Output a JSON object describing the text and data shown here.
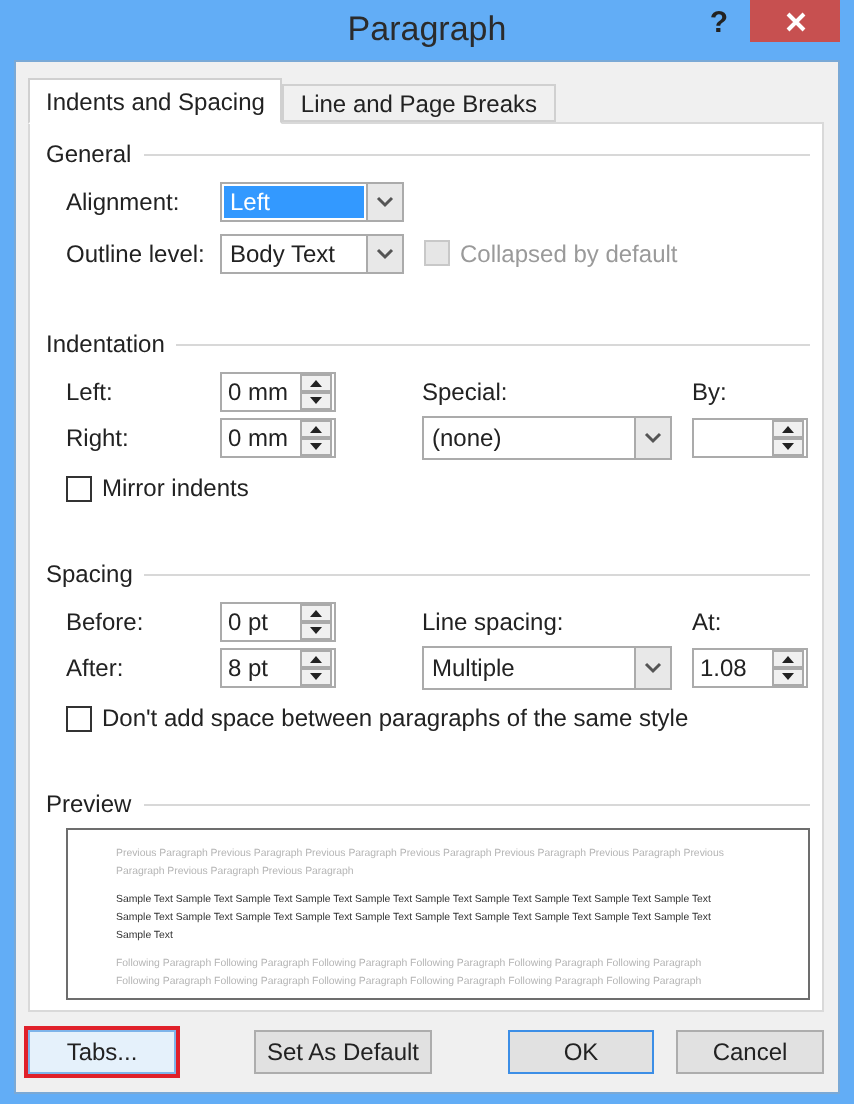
{
  "window": {
    "title": "Paragraph",
    "help": "?"
  },
  "tabs": [
    {
      "label": "Indents and Spacing",
      "selected": true
    },
    {
      "label": "Line and Page Breaks",
      "selected": false
    }
  ],
  "general": {
    "heading": "General",
    "alignment": {
      "label": "Alignment:",
      "value": "Left",
      "highlighted": true
    },
    "outline_level": {
      "label": "Outline level:",
      "value": "Body Text",
      "highlighted": false
    },
    "collapsed": {
      "label": "Collapsed by default",
      "checked": false,
      "disabled": true
    }
  },
  "indentation": {
    "heading": "Indentation",
    "left": {
      "label": "Left:",
      "value": "0 mm"
    },
    "right": {
      "label": "Right:",
      "value": "0 mm"
    },
    "special": {
      "label": "Special:",
      "value": "(none)"
    },
    "by": {
      "label": "By:"
    },
    "mirror": {
      "label": "Mirror indents",
      "checked": false,
      "disabled": false
    }
  },
  "spacing": {
    "heading": "Spacing",
    "before": {
      "label": "Before:",
      "value": "0 pt"
    },
    "after": {
      "label": "After:",
      "value": "8 pt"
    },
    "line_spacing": {
      "label": "Line spacing:",
      "value": "Multiple"
    },
    "at": {
      "label": "At:",
      "value": "1.08"
    },
    "dont_add": {
      "label": "Don't add space between paragraphs of the same style",
      "checked": false,
      "disabled": false
    }
  },
  "preview": {
    "heading": "Preview",
    "previous": "Previous Paragraph Previous Paragraph Previous Paragraph Previous Paragraph Previous Paragraph Previous Paragraph Previous Paragraph Previous Paragraph Previous Paragraph",
    "sample": "Sample Text Sample Text Sample Text Sample Text Sample Text Sample Text Sample Text Sample Text Sample Text Sample Text Sample Text Sample Text Sample Text Sample Text Sample Text Sample Text Sample Text Sample Text Sample Text Sample Text Sample Text",
    "following": "Following Paragraph Following Paragraph Following Paragraph Following Paragraph Following Paragraph Following Paragraph Following Paragraph Following Paragraph Following Paragraph Following Paragraph Following Paragraph Following Paragraph"
  },
  "buttons": [
    {
      "label": "Tabs...",
      "kind": "marked"
    },
    {
      "label": "Set As Default",
      "kind": "normal"
    },
    {
      "label": "OK",
      "kind": "default"
    },
    {
      "label": "Cancel",
      "kind": "normal"
    }
  ]
}
